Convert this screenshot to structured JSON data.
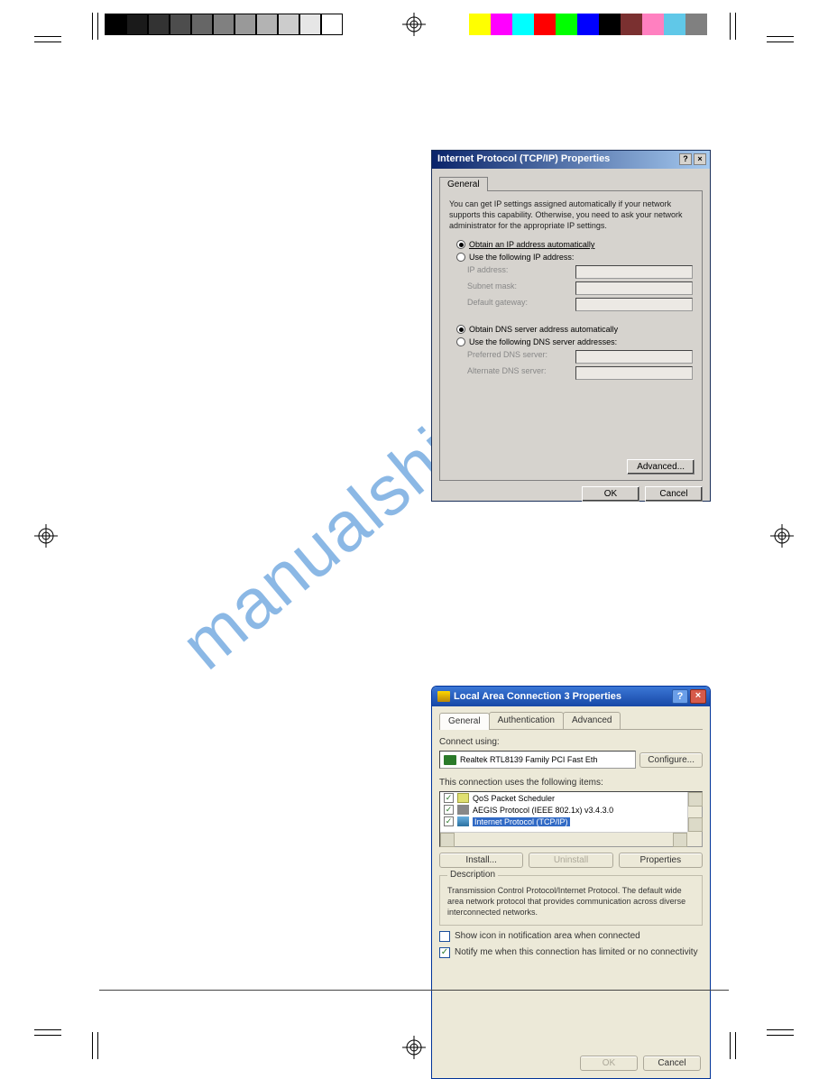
{
  "watermark": "manualshive.com",
  "colorbar_gray": [
    "#000000",
    "#1a1a1a",
    "#333333",
    "#4d4d4d",
    "#666666",
    "#808080",
    "#999999",
    "#b3b3b3",
    "#cccccc",
    "#e6e6e6",
    "#ffffff"
  ],
  "colorbar_hues": [
    "#ffff00",
    "#ff00ff",
    "#00ffff",
    "#ff0000",
    "#00ff00",
    "#0000ff",
    "#000000",
    "#7a3030",
    "#ff80c0",
    "#60c8e8",
    "#808080"
  ],
  "dlg1": {
    "title": "Internet Protocol (TCP/IP) Properties",
    "tab": "General",
    "intro": "You can get IP settings assigned automatically if your network supports this capability. Otherwise, you need to ask your network administrator for the appropriate IP settings.",
    "radio_auto_ip": "Obtain an IP address automatically",
    "radio_use_ip": "Use the following IP address:",
    "ip_label": "IP address:",
    "subnet_label": "Subnet mask:",
    "gateway_label": "Default gateway:",
    "radio_auto_dns": "Obtain DNS server address automatically",
    "radio_use_dns": "Use the following DNS server addresses:",
    "pref_dns": "Preferred DNS server:",
    "alt_dns": "Alternate DNS server:",
    "advanced": "Advanced...",
    "ok": "OK",
    "cancel": "Cancel",
    "help": "?",
    "close": "×"
  },
  "dlg2": {
    "title": "Local Area Connection 3 Properties",
    "help": "?",
    "close": "×",
    "tabs": {
      "general": "General",
      "auth": "Authentication",
      "adv": "Advanced"
    },
    "connect_using": "Connect using:",
    "adapter": "Realtek RTL8139 Family PCI Fast Eth",
    "configure": "Configure...",
    "uses_items": "This connection uses the following items:",
    "items": {
      "qos": "QoS Packet Scheduler",
      "aegis": "AEGIS Protocol (IEEE 802.1x) v3.4.3.0",
      "tcp": "Internet Protocol (TCP/IP)"
    },
    "install": "Install...",
    "uninstall": "Uninstall",
    "properties": "Properties",
    "desc_title": "Description",
    "desc_text": "Transmission Control Protocol/Internet Protocol. The default wide area network protocol that provides communication across diverse interconnected networks.",
    "show_icon": "Show icon in notification area when connected",
    "notify": "Notify me when this connection has limited or no connectivity",
    "ok": "OK",
    "cancel": "Cancel"
  }
}
